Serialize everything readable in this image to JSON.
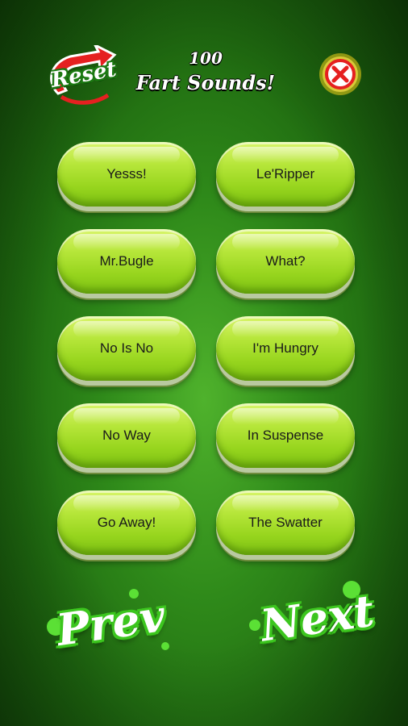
{
  "header": {
    "reset_label": "Reset",
    "title_line1": "100",
    "title_line2": "Fart Sounds!"
  },
  "sounds": [
    "Yesss!",
    "Le'Ripper",
    "Mr.Bugle",
    "What?",
    "No Is No",
    "I'm Hungry",
    "No Way",
    "In Suspense",
    "Go Away!",
    "The Swatter"
  ],
  "nav": {
    "prev_label": "Prev",
    "next_label": "Next"
  },
  "colors": {
    "background": "#2f8a1a",
    "button": "#a8de2c",
    "accent_red": "#e52020",
    "close_glow": "#f2d21a"
  },
  "icons": {
    "reset": "reset-arrow-icon",
    "close": "close-x-icon"
  }
}
